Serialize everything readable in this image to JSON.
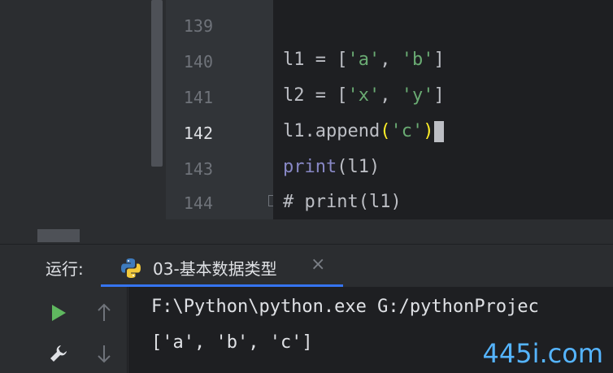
{
  "editor": {
    "lines": [
      {
        "num": "139",
        "tokens": []
      },
      {
        "num": "140",
        "tokens": [
          {
            "t": "l1 = [",
            "c": "plain"
          },
          {
            "t": "'a'",
            "c": "str"
          },
          {
            "t": ", ",
            "c": "plain"
          },
          {
            "t": "'b'",
            "c": "str"
          },
          {
            "t": "]",
            "c": "plain"
          }
        ]
      },
      {
        "num": "141",
        "tokens": [
          {
            "t": "l2 = [",
            "c": "plain"
          },
          {
            "t": "'x'",
            "c": "str"
          },
          {
            "t": ", ",
            "c": "plain"
          },
          {
            "t": "'y'",
            "c": "str"
          },
          {
            "t": "]",
            "c": "plain"
          }
        ]
      },
      {
        "num": "142",
        "tokens": [
          {
            "t": "l1.append",
            "c": "plain"
          },
          {
            "t": "(",
            "c": "paren"
          },
          {
            "t": "'c'",
            "c": "str"
          },
          {
            "t": ")",
            "c": "paren"
          }
        ],
        "current": true
      },
      {
        "num": "143",
        "tokens": [
          {
            "t": "print",
            "c": "fn"
          },
          {
            "t": "(l1)",
            "c": "plain"
          }
        ]
      },
      {
        "num": "144",
        "tokens": [
          {
            "t": "# print(l1)",
            "c": "plain"
          }
        ]
      }
    ]
  },
  "run": {
    "label": "运行:",
    "tab_title": "03-基本数据类型",
    "tab_close": "×",
    "icons": [
      "run-icon",
      "wrench-icon",
      "arrow-up-icon",
      "arrow-down-icon",
      "python-icon"
    ]
  },
  "console": {
    "line1": "F:\\Python\\python.exe G:/pythonProjec",
    "line2": "['a', 'b', 'c']"
  },
  "watermark": "445i.com",
  "colors": {
    "editor_bg": "#1e1f22",
    "string": "#6aab73",
    "builtin": "#8888c6",
    "paren_highlight": "#ffef28",
    "run_green": "#5fb85f",
    "tab_underline": "#3574f0",
    "watermark": "#55b4ff"
  }
}
